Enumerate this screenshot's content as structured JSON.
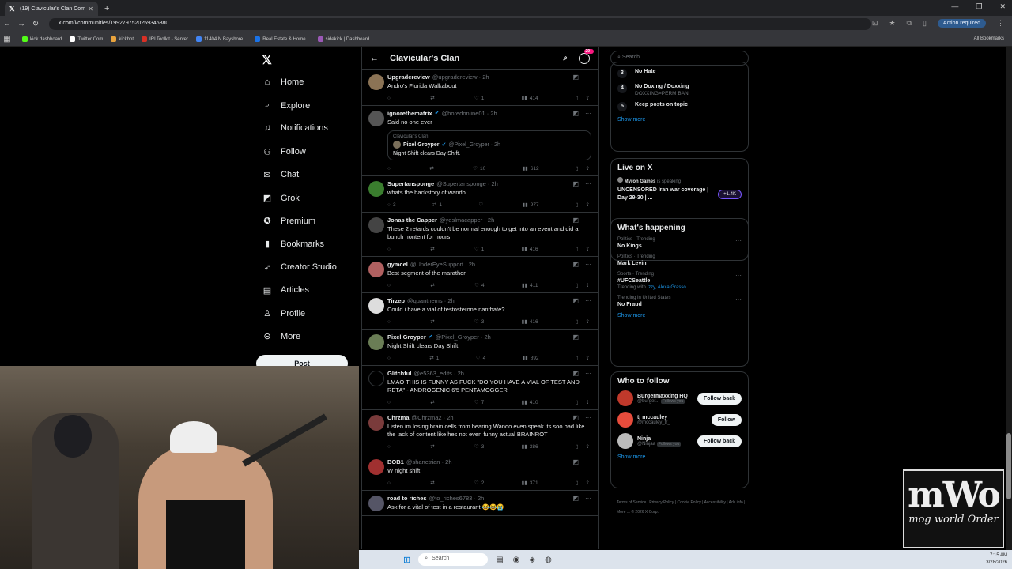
{
  "browser": {
    "tab_title": "(19) Clavicular's Clan Commun...",
    "url": "x.com/i/communities/1992797520259346880",
    "action_required": "Action required",
    "all_bookmarks": "All Bookmarks",
    "bookmarks": [
      {
        "label": "kick dashboard",
        "color": "#53fc18"
      },
      {
        "label": "Twitter Com",
        "color": "#ffffff"
      },
      {
        "label": "kickbot",
        "color": "#e8a33d"
      },
      {
        "label": "IRLToolkit - Server",
        "color": "#d93025"
      },
      {
        "label": "11404 N Bayshore...",
        "color": "#4285f4"
      },
      {
        "label": "Real Estate & Home...",
        "color": "#1a73e8"
      },
      {
        "label": "sidekick | Dashboard",
        "color": "#9b59b6"
      }
    ]
  },
  "nav": {
    "items": [
      {
        "label": "Home",
        "icon": "home-icon",
        "glyph": "⌂"
      },
      {
        "label": "Explore",
        "icon": "search-icon",
        "glyph": "⌕"
      },
      {
        "label": "Notifications",
        "icon": "bell-icon",
        "glyph": "♫"
      },
      {
        "label": "Follow",
        "icon": "person-add-icon",
        "glyph": "⚇"
      },
      {
        "label": "Chat",
        "icon": "mail-icon",
        "glyph": "✉"
      },
      {
        "label": "Grok",
        "icon": "grok-icon",
        "glyph": "◩"
      },
      {
        "label": "Premium",
        "icon": "premium-icon",
        "glyph": "✪"
      },
      {
        "label": "Bookmarks",
        "icon": "bookmark-icon",
        "glyph": "▮"
      },
      {
        "label": "Creator Studio",
        "icon": "rocket-icon",
        "glyph": "➶"
      },
      {
        "label": "Articles",
        "icon": "article-icon",
        "glyph": "▤"
      },
      {
        "label": "Profile",
        "icon": "profile-icon",
        "glyph": "♙"
      },
      {
        "label": "More",
        "icon": "more-icon",
        "glyph": "⊝"
      }
    ],
    "notif_badge": "19",
    "post_label": "Post"
  },
  "feed": {
    "title": "Clavicular's Clan",
    "grok_count": "20+",
    "posts": [
      {
        "name": "Upgradereview",
        "handle": "@upgradereview · 2h",
        "text": "Andro's Florida Walkabout",
        "verified": "",
        "reply": "",
        "retweet": "",
        "like": "1",
        "views": "414",
        "avatar": "#8b7355"
      },
      {
        "name": "ignorethematrix",
        "handle": "@boredonline01 · 2h",
        "text": "Said no one ever",
        "verified": "✔",
        "reply": "",
        "retweet": "",
        "like": "10",
        "views": "612",
        "avatar": "#555",
        "quote": {
          "community": "Clavicular's Clan",
          "name": "Pixel Groyper",
          "handle": "@Pixel_Groyper · 2h",
          "text": "Night Shift clears Day Shift."
        }
      },
      {
        "name": "Supertansponge",
        "handle": "@Supertansponge · 2h",
        "text": "whats the backstory of wando",
        "verified": "",
        "reply": "3",
        "retweet": "1",
        "like": "",
        "views": "977",
        "avatar": "#3a7d2e"
      },
      {
        "name": "Jonas the Capper",
        "handle": "@yeslmacapper · 2h",
        "text": "These 2 retards couldn't be normal enough to get into an event and did a bunch nontent for hours",
        "verified": "",
        "reply": "",
        "retweet": "",
        "like": "1",
        "views": "416",
        "avatar": "#444"
      },
      {
        "name": "gymcel",
        "handle": "@UnderEyeSupport · 2h",
        "text": "Best segment of the marathon",
        "verified": "",
        "reply": "",
        "retweet": "",
        "like": "4",
        "views": "411",
        "avatar": "#b06060"
      },
      {
        "name": "Tirzep",
        "handle": "@quantnems · 2h",
        "text": "Could i have a vial of testosterone nanthate?",
        "verified": "",
        "reply": "",
        "retweet": "",
        "like": "3",
        "views": "416",
        "avatar": "#ddd"
      },
      {
        "name": "Pixel Groyper",
        "handle": "@Pixel_Groyper · 2h",
        "text": "Night Shift clears Day Shift.",
        "verified": "✔",
        "reply": "",
        "retweet": "1",
        "like": "4",
        "views": "892",
        "avatar": "#6a7d55"
      },
      {
        "name": "Glitchful",
        "handle": "@e5363_edits · 2h",
        "text": "LMAO THIS IS FUNNY AS FUCK \"DO YOU HAVE A VIAL OF TEST AND RETA\" - ANDROGENIC 6'5 PENTAMOGGER",
        "verified": "",
        "reply": "",
        "retweet": "",
        "like": "7",
        "views": "410",
        "avatar": "#000"
      },
      {
        "name": "Chrzma",
        "handle": "@Chrzma2 · 2h",
        "text": "Listen im losing brain cells from hearing Wando even speak its soo bad like the lack of content like hes not even funny actual BRAINROT",
        "verified": "",
        "reply": "",
        "retweet": "",
        "like": "3",
        "views": "386",
        "avatar": "#7a3b3b"
      },
      {
        "name": "BOB1",
        "handle": "@shanetrian · 2h",
        "text": "W night shift",
        "verified": "",
        "reply": "",
        "retweet": "",
        "like": "2",
        "views": "371",
        "avatar": "#a03030"
      },
      {
        "name": "road to riches",
        "handle": "@to_riches6783 · 2h",
        "text": "Ask for a vital of test in a restaurant 😂😂😭",
        "verified": "",
        "reply": "",
        "retweet": "",
        "like": "",
        "views": "",
        "avatar": "#556"
      }
    ]
  },
  "right": {
    "search_placeholder": "Search",
    "rules": [
      {
        "num": "3",
        "title": "No Hate",
        "sub": ""
      },
      {
        "num": "4",
        "title": "No Doxing / Doxxing",
        "sub": "DOXXING=PERM BAN"
      },
      {
        "num": "5",
        "title": "Keep posts on topic",
        "sub": ""
      }
    ],
    "show_more": "Show more",
    "live_title": "Live on X",
    "live_host": "Myron Gaines",
    "live_speaking": "is speaking",
    "live_text": "UNCENSORED Iran war coverage | Day 29-30 | ...",
    "live_count": "+1.4K",
    "happening_title": "What's happening",
    "trends": [
      {
        "ctx": "Politics · Trending",
        "title": "No Kings",
        "with": ""
      },
      {
        "ctx": "Politics · Trending",
        "title": "Mark Levin",
        "with": ""
      },
      {
        "ctx": "Sports · Trending",
        "title": "#UFCSeattle",
        "with": "Izzy, Alexa Grasso"
      },
      {
        "ctx": "Trending in United States",
        "title": "No Fraud",
        "with": ""
      }
    ],
    "trending_with": "Trending with",
    "who_title": "Who to follow",
    "who": [
      {
        "name": "Burgermaxxing HQ",
        "handle": "@burger...",
        "follows": "Follows you",
        "btn": "Follow back",
        "avatar": "#c0392b"
      },
      {
        "name": "tj mccauley",
        "handle": "@mccauley_tr_",
        "follows": "",
        "btn": "Follow",
        "avatar": "#e74c3c"
      },
      {
        "name": "Ninja",
        "handle": "@Ninjaa",
        "follows": "Follows you",
        "btn": "Follow back",
        "avatar": "#bbb"
      }
    ],
    "footer": "Terms of Service | Privacy Policy | Cookie Policy | Accessibility | Ads info | More ... © 2026 X Corp."
  },
  "taskbar": {
    "search": "Search",
    "time": "7:15 AM",
    "date": "3/28/2026"
  },
  "overlay_logo": {
    "big": "mWo",
    "small": "mog world Order"
  }
}
